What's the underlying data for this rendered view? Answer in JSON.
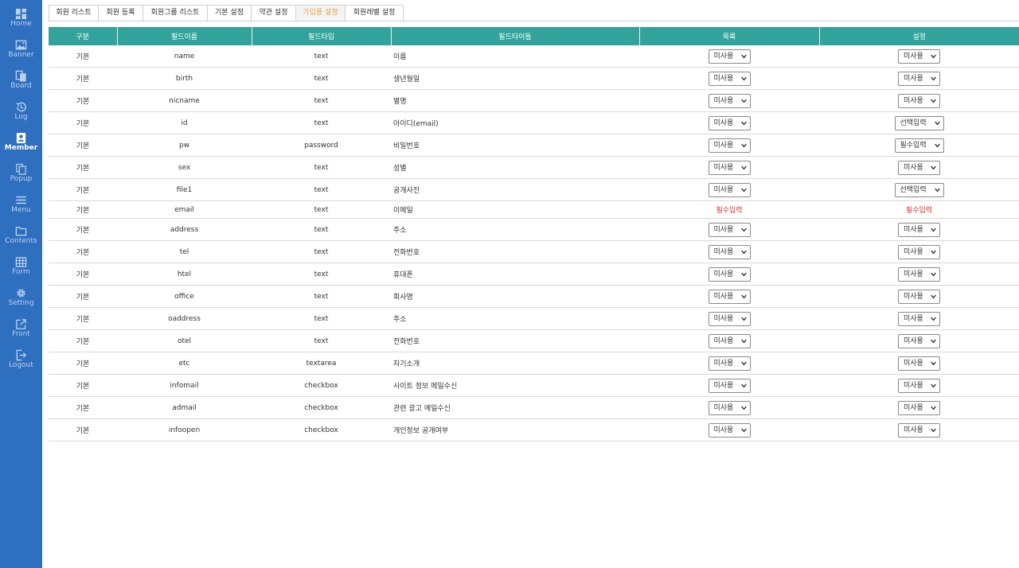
{
  "sidebar": {
    "items": [
      {
        "label": "Home",
        "icon": "home-icon"
      },
      {
        "label": "Banner",
        "icon": "image-icon"
      },
      {
        "label": "Board",
        "icon": "board-icon"
      },
      {
        "label": "Log",
        "icon": "history-icon"
      },
      {
        "label": "Member",
        "icon": "member-badge-icon",
        "active": true
      },
      {
        "label": "Popup",
        "icon": "copy-icon"
      },
      {
        "label": "Menu",
        "icon": "list-icon"
      },
      {
        "label": "Contents",
        "icon": "folder-icon"
      },
      {
        "label": "Form",
        "icon": "table-icon"
      },
      {
        "label": "Setting",
        "icon": "gear-icon"
      },
      {
        "label": "Front",
        "icon": "external-link-icon"
      },
      {
        "label": "Logout",
        "icon": "logout-icon"
      }
    ]
  },
  "tabs": [
    {
      "label": "회원 리스트"
    },
    {
      "label": "회원 등록"
    },
    {
      "label": "회원그룹 리스트"
    },
    {
      "label": "기본 설정"
    },
    {
      "label": "약관 설정"
    },
    {
      "label": "가입폼 설정",
      "active": true
    },
    {
      "label": "회원레벨 설정"
    }
  ],
  "table": {
    "headers": [
      "구분",
      "필드이름",
      "필드타입",
      "필드타이틀",
      "목록",
      "설정"
    ],
    "rows": [
      {
        "type": "기본",
        "name": "name",
        "ftype": "text",
        "title": "이름",
        "list": "미사용",
        "setting": "미사용"
      },
      {
        "type": "기본",
        "name": "birth",
        "ftype": "text",
        "title": "생년월일",
        "list": "미사용",
        "setting": "미사용"
      },
      {
        "type": "기본",
        "name": "nicname",
        "ftype": "text",
        "title": "별명",
        "list": "미사용",
        "setting": "미사용"
      },
      {
        "type": "기본",
        "name": "id",
        "ftype": "text",
        "title": "아이디(email)",
        "list": "미사용",
        "setting": "선택입력"
      },
      {
        "type": "기본",
        "name": "pw",
        "ftype": "password",
        "title": "비밀번호",
        "list": "미사용",
        "setting": "필수입력"
      },
      {
        "type": "기본",
        "name": "sex",
        "ftype": "text",
        "title": "성별",
        "list": "미사용",
        "setting": "미사용"
      },
      {
        "type": "기본",
        "name": "file1",
        "ftype": "text",
        "title": "공개사진",
        "list": "미사용",
        "setting": "선택입력"
      },
      {
        "type": "기본",
        "name": "email",
        "ftype": "text",
        "title": "이메일",
        "list": "필수입력",
        "setting": "필수입력",
        "fixed": true
      },
      {
        "type": "기본",
        "name": "address",
        "ftype": "text",
        "title": "주소",
        "list": "미사용",
        "setting": "미사용"
      },
      {
        "type": "기본",
        "name": "tel",
        "ftype": "text",
        "title": "전화번호",
        "list": "미사용",
        "setting": "미사용"
      },
      {
        "type": "기본",
        "name": "htel",
        "ftype": "text",
        "title": "휴대폰",
        "list": "미사용",
        "setting": "미사용"
      },
      {
        "type": "기본",
        "name": "office",
        "ftype": "text",
        "title": "회사명",
        "list": "미사용",
        "setting": "미사용"
      },
      {
        "type": "기본",
        "name": "oaddress",
        "ftype": "text",
        "title": "주소",
        "list": "미사용",
        "setting": "미사용"
      },
      {
        "type": "기본",
        "name": "otel",
        "ftype": "text",
        "title": "전화번호",
        "list": "미사용",
        "setting": "미사용"
      },
      {
        "type": "기본",
        "name": "etc",
        "ftype": "textarea",
        "title": "자기소개",
        "list": "미사용",
        "setting": "미사용"
      },
      {
        "type": "기본",
        "name": "infomail",
        "ftype": "checkbox",
        "title": "사이트 정보 메일수신",
        "list": "미사용",
        "setting": "미사용"
      },
      {
        "type": "기본",
        "name": "admail",
        "ftype": "checkbox",
        "title": "관련 광고 메일수신",
        "list": "미사용",
        "setting": "미사용"
      },
      {
        "type": "기본",
        "name": "infoopen",
        "ftype": "checkbox",
        "title": "개인정보 공개여부",
        "list": "미사용",
        "setting": "미사용"
      }
    ]
  },
  "colors": {
    "sidebar": "#2f6fc0",
    "header": "#31a39b",
    "active_tab": "#e8a33b",
    "required": "#d0342c"
  }
}
